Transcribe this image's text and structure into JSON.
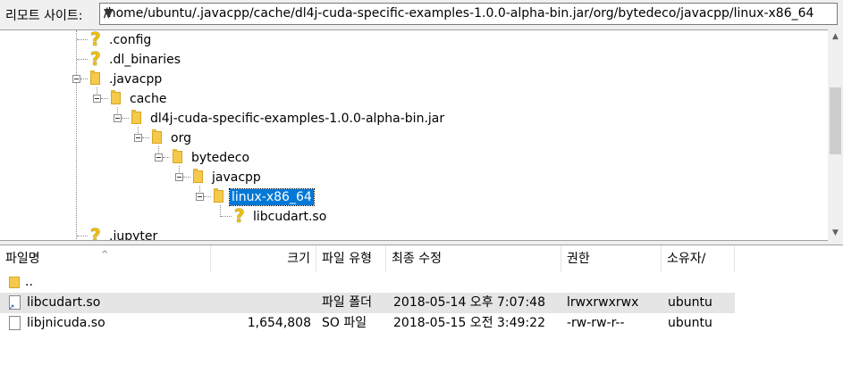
{
  "path_bar": {
    "label": "리모트 사이트:",
    "value": "/home/ubuntu/.javacpp/cache/dl4j-cuda-specific-examples-1.0.0-alpha-bin.jar/org/bytedeco/javacpp/linux-x86_64"
  },
  "tree": {
    "nodes": [
      {
        "label": ".config",
        "icon": "question-icon"
      },
      {
        "label": ".dl_binaries",
        "icon": "question-icon"
      },
      {
        "label": ".javacpp",
        "icon": "folder-icon"
      },
      {
        "label": "cache",
        "icon": "folder-icon"
      },
      {
        "label": "dl4j-cuda-specific-examples-1.0.0-alpha-bin.jar",
        "icon": "folder-icon"
      },
      {
        "label": "org",
        "icon": "folder-icon"
      },
      {
        "label": "bytedeco",
        "icon": "folder-icon"
      },
      {
        "label": "javacpp",
        "icon": "folder-icon"
      },
      {
        "label": "linux-x86_64",
        "icon": "folder-icon",
        "selected": true
      },
      {
        "label": "libcudart.so",
        "icon": "question-icon"
      },
      {
        "label": ".jupyter",
        "icon": "question-icon"
      }
    ]
  },
  "file_list": {
    "columns": [
      "파일명",
      "크기",
      "파일 유형",
      "최종 수정",
      "권한",
      "소유자/"
    ],
    "rows": [
      {
        "name": "..",
        "size": "",
        "type": "",
        "modified": "",
        "perms": "",
        "owner": "",
        "icon": "folder-icon"
      },
      {
        "name": "libcudart.so",
        "size": "",
        "type": "파일 폴더",
        "modified": "2018-05-14 오후 7:07:48",
        "perms": "lrwxrwxrwx",
        "owner": "ubuntu",
        "icon": "symlink-file-icon",
        "selected": true
      },
      {
        "name": "libjnicuda.so",
        "size": "1,654,808",
        "type": "SO 파일",
        "modified": "2018-05-15 오전 3:49:22",
        "perms": "-rw-rw-r--",
        "owner": "ubuntu",
        "icon": "file-icon"
      }
    ]
  }
}
